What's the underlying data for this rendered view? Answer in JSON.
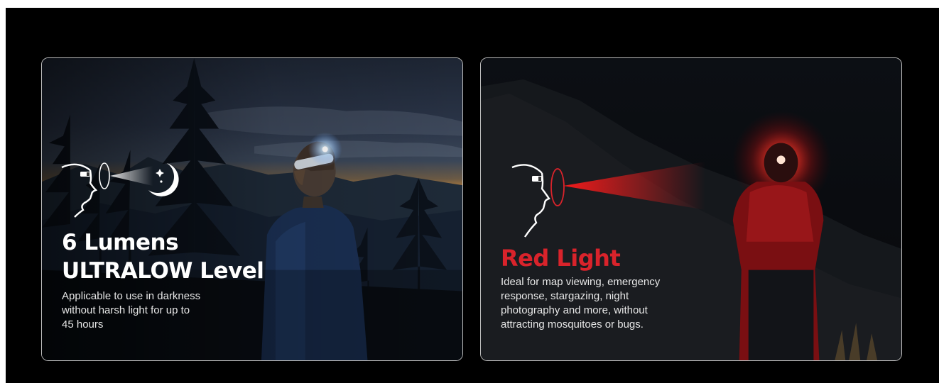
{
  "cards": [
    {
      "headline_line1": "6 Lumens",
      "headline_line2": "ULTRALOW Level",
      "description_lines": [
        "Applicable to use in darkness",
        "without harsh light for up to",
        "45 hours"
      ],
      "icons": [
        "headlamp-head-icon",
        "moon-icon"
      ],
      "accent_color": "#ffffff"
    },
    {
      "headline_line1": "Red Light",
      "description_lines": [
        "Ideal for map viewing, emergency",
        "response, stargazing, night",
        "photography and more, without",
        "attracting mosquitoes or bugs."
      ],
      "icons": [
        "headlamp-head-red-icon"
      ],
      "accent_color": "#d9232b"
    }
  ]
}
